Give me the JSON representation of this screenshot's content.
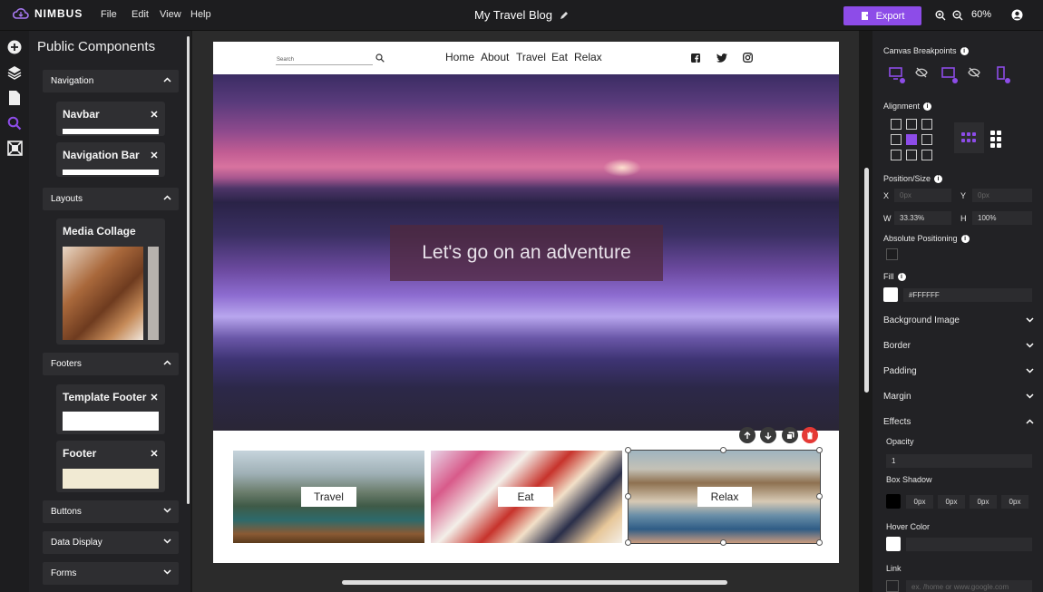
{
  "app": {
    "name": "NIMBUS",
    "menu": [
      "File",
      "Edit",
      "View",
      "Help"
    ],
    "doc_title": "My Travel Blog",
    "export_label": "Export",
    "zoom": "60%"
  },
  "left_panel": {
    "title": "Public Components",
    "sections": {
      "navigation": "Navigation",
      "layouts": "Layouts",
      "footers": "Footers",
      "buttons": "Buttons",
      "data_display": "Data Display",
      "forms": "Forms"
    },
    "cards": {
      "navbar": "Navbar",
      "navigation_bar": "Navigation Bar",
      "media_collage": "Media Collage",
      "template_footer": "Template Footer",
      "footer": "Footer"
    }
  },
  "canvas": {
    "search_placeholder": "Search",
    "nav": [
      "Home",
      "About",
      "Travel",
      "Eat",
      "Relax"
    ],
    "hero_text": "Let's go on an adventure",
    "tiles": [
      "Travel",
      "Eat",
      "Relax"
    ]
  },
  "right_panel": {
    "canvas_breakpoints": "Canvas Breakpoints",
    "alignment": "Alignment",
    "position_size": "Position/Size",
    "x_label": "X",
    "x_value": "0px",
    "y_label": "Y",
    "y_value": "0px",
    "w_label": "W",
    "w_value": "33.33%",
    "h_label": "H",
    "h_value": "100%",
    "absolute_positioning": "Absolute Positioning",
    "fill": "Fill",
    "fill_value": "#FFFFFF",
    "background_image": "Background Image",
    "border": "Border",
    "padding": "Padding",
    "margin": "Margin",
    "effects": "Effects",
    "opacity": "Opacity",
    "opacity_value": "1",
    "box_shadow": "Box Shadow",
    "box_shadow_values": [
      "0px",
      "0px",
      "0px",
      "0px"
    ],
    "hover_color": "Hover Color",
    "link": "Link",
    "link_placeholder": "ex. /home or www.google.com"
  },
  "colors": {
    "accent": "#8d4ce8",
    "delete": "#e53935"
  }
}
